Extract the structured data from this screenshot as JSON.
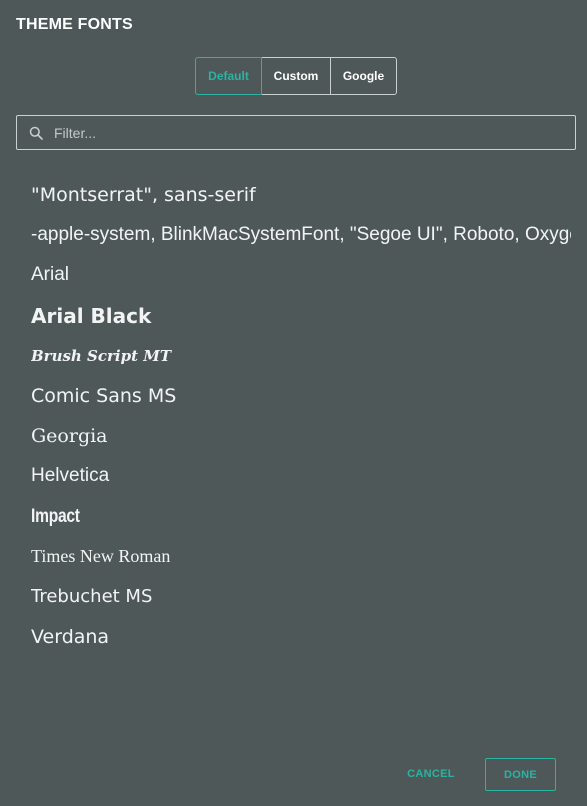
{
  "header": {
    "title": "THEME FONTS"
  },
  "tabs": [
    {
      "label": "Default",
      "active": true
    },
    {
      "label": "Custom",
      "active": false
    },
    {
      "label": "Google",
      "active": false
    }
  ],
  "search": {
    "placeholder": "Filter...",
    "value": "",
    "icon": "search-icon"
  },
  "fonts": [
    {
      "label": "\"Montserrat\", sans-serif"
    },
    {
      "label": "-apple-system, BlinkMacSystemFont, \"Segoe UI\", Roboto, Oxygen-Sans, Ubuntu, Cantarell, \"Helvetica Neue\", sans-serif"
    },
    {
      "label": "Arial"
    },
    {
      "label": "Arial Black"
    },
    {
      "label": "Brush Script MT"
    },
    {
      "label": "Comic Sans MS"
    },
    {
      "label": "Georgia"
    },
    {
      "label": "Helvetica"
    },
    {
      "label": "Impact"
    },
    {
      "label": "Times New Roman"
    },
    {
      "label": "Trebuchet MS"
    },
    {
      "label": "Verdana"
    }
  ],
  "actions": {
    "cancel_label": "CANCEL",
    "done_label": "DONE"
  },
  "colors": {
    "background": "#4f5859",
    "accent": "#2ab3a3",
    "border": "#c9d0d0",
    "text": "#ffffff"
  }
}
